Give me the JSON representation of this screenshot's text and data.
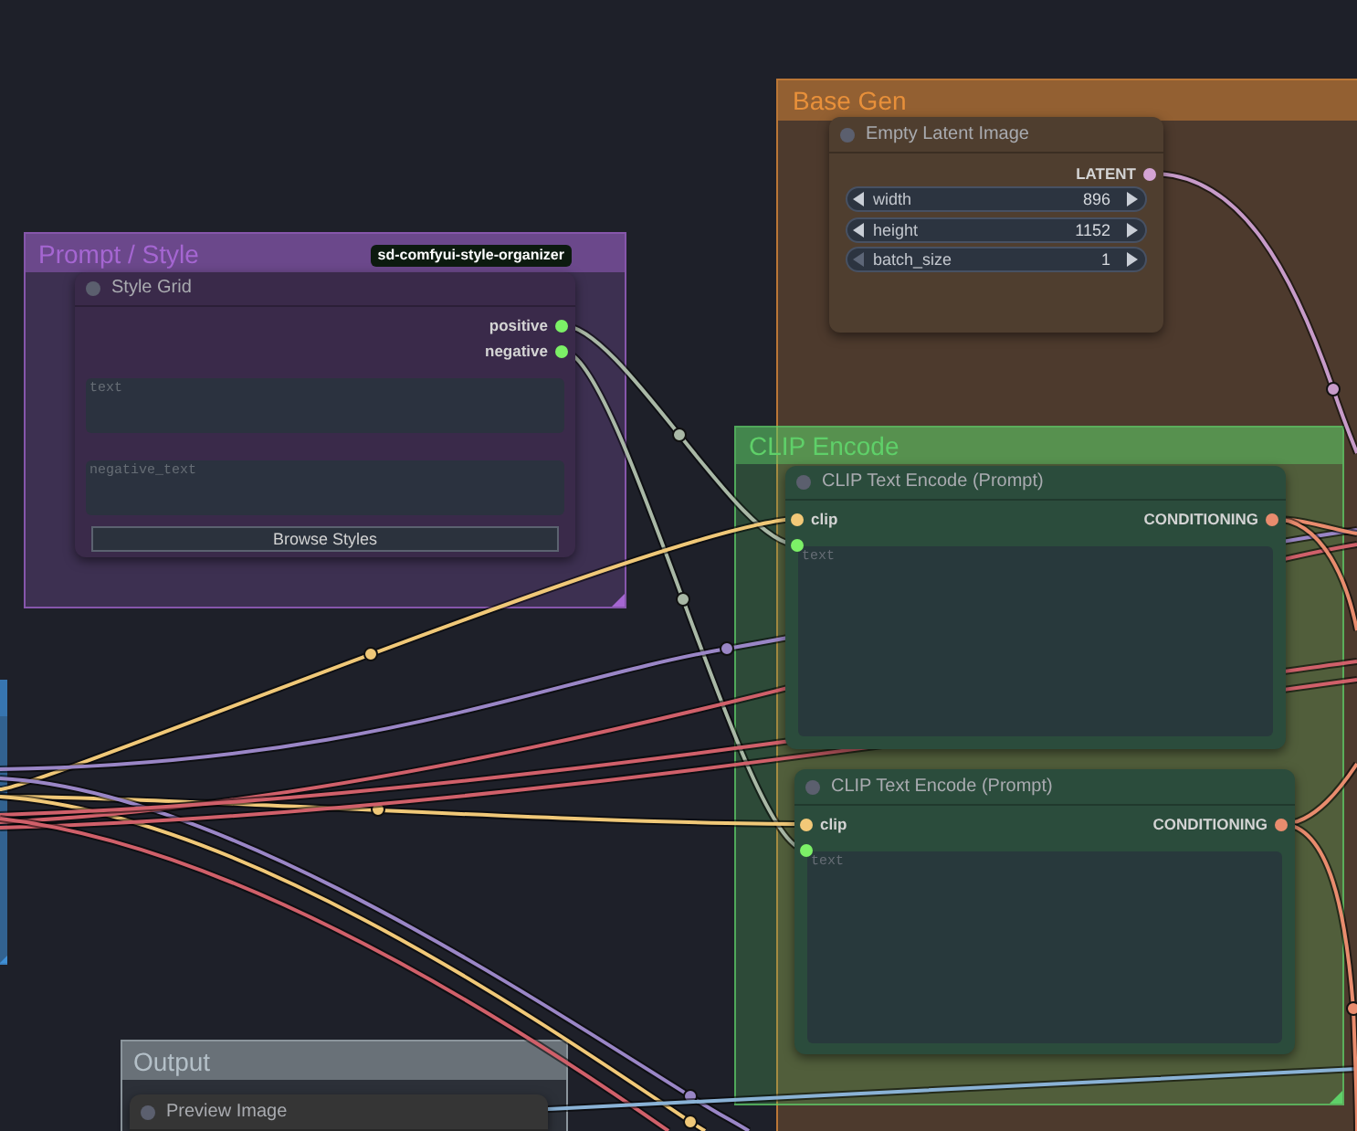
{
  "groups": [
    {
      "title": "Prompt / Style",
      "color": "#a566d2"
    },
    {
      "title": "Base Gen",
      "color": "#e8903a"
    },
    {
      "title": "CLIP Encode",
      "color": "#5fd069"
    },
    {
      "title": "Output",
      "color": "#b4c0c8"
    },
    {
      "color": "#3f8fd6"
    }
  ],
  "nodes": [
    {
      "title": "Style Grid",
      "color": "#3a2a4a",
      "badge": "sd-comfyui-style-organizer",
      "outputs": [
        {
          "name": "positive",
          "color": "#7cf067"
        },
        {
          "name": "negative",
          "color": "#7cf067"
        }
      ],
      "widgets": [
        {
          "kind": "textarea",
          "placeholder": "text"
        },
        {
          "kind": "textarea",
          "placeholder": "negative_text"
        },
        {
          "kind": "button",
          "label": "Browse Styles"
        }
      ]
    },
    {
      "title": "Empty Latent Image",
      "color": "#4f3e2f",
      "outputs": [
        {
          "name": "LATENT",
          "color": "#d4a4d4"
        }
      ],
      "widgets": [
        {
          "kind": "number",
          "label": "width",
          "value": "896",
          "decrement_disabled": false
        },
        {
          "kind": "number",
          "label": "height",
          "value": "1152",
          "decrement_disabled": false
        },
        {
          "kind": "number",
          "label": "batch_size",
          "value": "1",
          "decrement_disabled": true
        }
      ]
    },
    {
      "title": "CLIP Text Encode (Prompt)",
      "color": "#2b4c3c",
      "inputs": [
        {
          "name": "clip",
          "color": "#f2c878"
        },
        {
          "color": "#7cf067"
        }
      ],
      "outputs": [
        {
          "name": "CONDITIONING",
          "color": "#e98c6e"
        }
      ],
      "widgets": [
        {
          "kind": "textarea",
          "placeholder": "text"
        }
      ]
    },
    {
      "title": "CLIP Text Encode (Prompt)",
      "color": "#2b4c3c",
      "inputs": [
        {
          "name": "clip",
          "color": "#f2c878"
        },
        {
          "color": "#7cf067"
        }
      ],
      "outputs": [
        {
          "name": "CONDITIONING",
          "color": "#e98c6e"
        }
      ],
      "widgets": [
        {
          "kind": "textarea",
          "placeholder": "text"
        }
      ]
    },
    {
      "title": "Preview Image",
      "color": "#353535"
    }
  ]
}
